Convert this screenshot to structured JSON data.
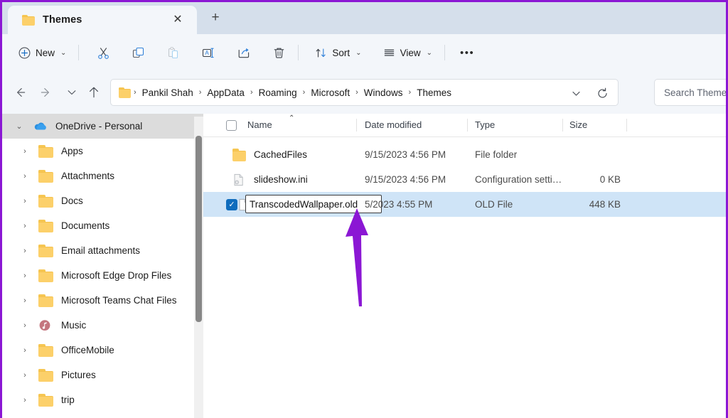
{
  "window": {
    "accent_border_color": "#8B17D4",
    "tabstrip_bg": "#d5dfeb",
    "chrome_bg": "#f3f6fa",
    "selection_color": "#cfe4f7",
    "checkbox_checked_color": "#0f6cbd"
  },
  "tabs": {
    "active": {
      "title": "Themes",
      "icon": "folder-icon"
    },
    "close_label": "✕",
    "new_tab_label": "+"
  },
  "toolbar": {
    "new_label": "New",
    "new_chevron": "⌄",
    "sort_label": "Sort",
    "sort_chevron": "⌄",
    "view_label": "View",
    "view_chevron": "⌄",
    "more_label": "•••",
    "items": [
      {
        "name": "cut-icon",
        "label": "Cut",
        "enabled": true
      },
      {
        "name": "copy-icon",
        "label": "Copy",
        "enabled": true
      },
      {
        "name": "paste-icon",
        "label": "Paste",
        "enabled": false
      },
      {
        "name": "rename-icon",
        "label": "Rename",
        "enabled": true
      },
      {
        "name": "share-icon",
        "label": "Share",
        "enabled": true
      },
      {
        "name": "delete-icon",
        "label": "Delete",
        "enabled": true
      }
    ]
  },
  "navigation": {
    "back_label": "←",
    "forward_label": "→",
    "recent_label": "⌄",
    "up_label": "↑"
  },
  "breadcrumb": {
    "separator": "›",
    "segments": [
      "Pankil Shah",
      "AppData",
      "Roaming",
      "Microsoft",
      "Windows",
      "Themes"
    ]
  },
  "search": {
    "placeholder": "Search Themes",
    "value": ""
  },
  "sidebar": {
    "items": [
      {
        "label": "OneDrive - Personal",
        "icon": "onedrive-cloud-icon",
        "chevron": "⌄",
        "selected": true,
        "indent": 0
      },
      {
        "label": "Apps",
        "icon": "folder-icon",
        "chevron": "›",
        "selected": false,
        "indent": 1
      },
      {
        "label": "Attachments",
        "icon": "folder-icon",
        "chevron": "›",
        "selected": false,
        "indent": 1
      },
      {
        "label": "Docs",
        "icon": "folder-icon",
        "chevron": "›",
        "selected": false,
        "indent": 1
      },
      {
        "label": "Documents",
        "icon": "folder-icon",
        "chevron": "›",
        "selected": false,
        "indent": 1
      },
      {
        "label": "Email attachments",
        "icon": "folder-icon",
        "chevron": "›",
        "selected": false,
        "indent": 1
      },
      {
        "label": "Microsoft Edge Drop Files",
        "icon": "folder-icon",
        "chevron": "›",
        "selected": false,
        "indent": 1
      },
      {
        "label": "Microsoft Teams Chat Files",
        "icon": "folder-icon",
        "chevron": "›",
        "selected": false,
        "indent": 1
      },
      {
        "label": "Music",
        "icon": "music-folder-icon",
        "chevron": "›",
        "selected": false,
        "indent": 1
      },
      {
        "label": "OfficeMobile",
        "icon": "folder-icon",
        "chevron": "›",
        "selected": false,
        "indent": 1
      },
      {
        "label": "Pictures",
        "icon": "folder-icon",
        "chevron": "›",
        "selected": false,
        "indent": 1
      },
      {
        "label": "trip",
        "icon": "folder-icon",
        "chevron": "›",
        "selected": false,
        "indent": 1
      }
    ]
  },
  "filelist": {
    "columns": {
      "name": "Name",
      "date_modified": "Date modified",
      "type": "Type",
      "size": "Size",
      "sort_indicator": "⌃"
    },
    "rows": [
      {
        "name": "CachedFiles",
        "date_modified": "9/15/2023 4:56 PM",
        "type": "File folder",
        "size": "",
        "icon": "folder-icon",
        "selected": false,
        "checked": false,
        "renaming": false
      },
      {
        "name": "slideshow.ini",
        "date_modified": "9/15/2023 4:56 PM",
        "type": "Configuration setti…",
        "size": "0 KB",
        "icon": "config-file-icon",
        "selected": false,
        "checked": false,
        "renaming": false
      },
      {
        "name": "TranscodedWallpaper.old",
        "date_modified": "5/2023 4:55 PM",
        "type": "OLD File",
        "size": "448 KB",
        "icon": "generic-file-icon",
        "selected": true,
        "checked": true,
        "renaming": true,
        "rename_value": "TranscodedWallpaper.old"
      }
    ]
  },
  "annotation": {
    "arrow_color": "#8B17D4",
    "points_at": "rename-input"
  }
}
